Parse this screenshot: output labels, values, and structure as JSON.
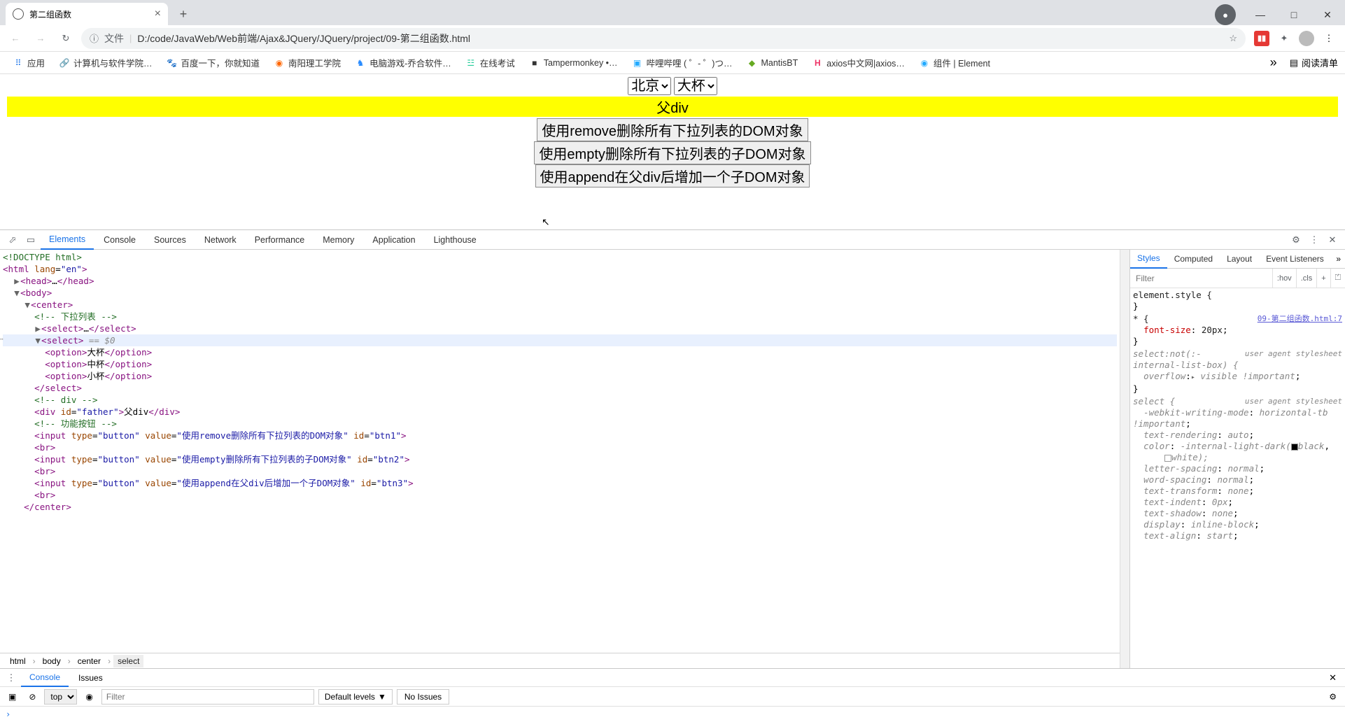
{
  "tab": {
    "title": "第二组函数",
    "close": "×"
  },
  "window": {
    "newtab": "+",
    "min": "—",
    "max": "□",
    "close": "✕"
  },
  "addressbar": {
    "info_icon": "ⓘ",
    "label": "文件",
    "url": "D:/code/JavaWeb/Web前端/Ajax&JQuery/JQuery/project/09-第二组函数.html"
  },
  "bookmarks": [
    {
      "icon": "apps",
      "label": "应用",
      "color": "#1a73e8"
    },
    {
      "icon": "link",
      "label": "计算机与软件学院…",
      "color": "#f90"
    },
    {
      "icon": "paw",
      "label": "百度一下，你就知道",
      "color": "#e53935"
    },
    {
      "icon": "edu",
      "label": "南阳理工学院",
      "color": "#f60"
    },
    {
      "icon": "game",
      "label": "电脑游戏-乔合软件…",
      "color": "#28f"
    },
    {
      "icon": "exam",
      "label": "在线考试",
      "color": "#2c9"
    },
    {
      "icon": "tm",
      "label": "Tampermonkey •…",
      "color": "#333"
    },
    {
      "icon": "bili",
      "label": "哔哩哔哩 ( ゜- ゜)つ…",
      "color": "#2af"
    },
    {
      "icon": "mb",
      "label": "MantisBT",
      "color": "#6a2"
    },
    {
      "icon": "ax",
      "label": "axios中文网|axios…",
      "color": "#e36"
    },
    {
      "icon": "el",
      "label": "组件 | Element",
      "color": "#2af"
    }
  ],
  "bookmarks_more": "»",
  "readinglist": "阅读清单",
  "page": {
    "select1": {
      "value": "北京"
    },
    "select2": {
      "value": "大杯",
      "options": [
        "大杯",
        "中杯",
        "小杯"
      ]
    },
    "father_div": "父div",
    "btn1": "使用remove删除所有下拉列表的DOM对象",
    "btn2": "使用empty删除所有下拉列表的子DOM对象",
    "btn3": "使用append在父div后增加一个子DOM对象"
  },
  "devtools": {
    "tabs": [
      "Elements",
      "Console",
      "Sources",
      "Network",
      "Performance",
      "Memory",
      "Application",
      "Lighthouse"
    ],
    "active_tab": "Elements",
    "breadcrumb": [
      "html",
      "body",
      "center",
      "select"
    ],
    "styles_tabs": [
      "Styles",
      "Computed",
      "Layout",
      "Event Listeners"
    ],
    "filter_placeholder": "Filter",
    "filter_btns": [
      ":hov",
      ".cls",
      "+"
    ],
    "rules": {
      "r0": {
        "sel": "element.style {",
        "close": "}"
      },
      "r1": {
        "sel": "* {",
        "src": "09-第二组函数.html:7",
        "p1": "font-size",
        "v1": "20px",
        "close": "}"
      },
      "r2": {
        "sel": "select:not(:-internal-list-box) {",
        "src": "user agent stylesheet",
        "p1": "overflow",
        "v1": "visible !important",
        "close": "}"
      },
      "r3": {
        "sel": "select {",
        "src": "user agent stylesheet",
        "p1": "-webkit-writing-mode",
        "v1": "horizontal-tb !important",
        "p2": "text-rendering",
        "v2": "auto",
        "p3": "color",
        "v3": "-internal-light-dark(",
        "v3a": "black",
        "v3b": "white",
        "v3c": ");",
        "p4": "letter-spacing",
        "v4": "normal",
        "p5": "word-spacing",
        "v5": "normal",
        "p6": "text-transform",
        "v6": "none",
        "p7": "text-indent",
        "v7": "0px",
        "p8": "text-shadow",
        "v8": "none",
        "p9": "display",
        "v9": "inline-block",
        "p10": "text-align",
        "v10": "start"
      }
    },
    "console_tabs": [
      "Console",
      "Issues"
    ],
    "console_toolbar": {
      "top": "top",
      "filter_placeholder": "Filter",
      "levels": "Default levels",
      "noissues": "No Issues"
    }
  },
  "dom": {
    "doctype": "<!DOCTYPE html>",
    "html_open": "html",
    "lang": "en",
    "head": "head",
    "body": "body",
    "center": "center",
    "cmt1": " 下拉列表 ",
    "select": "select",
    "option": "option",
    "o1": "大杯",
    "o2": "中杯",
    "o3": "小杯",
    "cmt2": " div ",
    "div": "div",
    "father_id": "father",
    "father_txt": "父div",
    "cmt3": " 功能按钮 ",
    "input": "input",
    "type": "type",
    "button": "button",
    "value": "value",
    "id": "id",
    "b1v": "使用remove删除所有下拉列表的DOM对象",
    "b1id": "btn1",
    "b2v": "使用empty删除所有下拉列表的子DOM对象",
    "b2id": "btn2",
    "b3v": "使用append在父div后增加一个子DOM对象",
    "b3id": "btn3",
    "br": "br",
    "eq0": " == $0"
  }
}
